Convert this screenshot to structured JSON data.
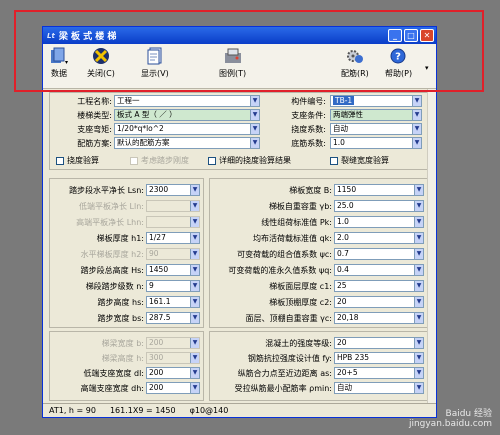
{
  "window": {
    "app_tag": "Lt",
    "title": "梁 板 式 楼 梯"
  },
  "toolbar": [
    {
      "name": "data-button",
      "label": "数据",
      "menu": true
    },
    {
      "name": "close-button",
      "label": "关闭(C)"
    },
    {
      "name": "display-button",
      "label": "显示(V)"
    },
    {
      "name": "drawing-button",
      "label": "图例(T)"
    },
    {
      "name": "rebar-button",
      "label": "配筋(R)"
    },
    {
      "name": "help-button",
      "label": "帮助(P)",
      "menu": true
    }
  ],
  "top": {
    "left": [
      {
        "label": "工程名称:",
        "value": "工程一"
      },
      {
        "label": "楼梯类型:",
        "value": "板式 A 型（ ／ ）"
      },
      {
        "label": "支座弯矩:",
        "value": "1/20*q*lo^2"
      },
      {
        "label": "配筋方案:",
        "value": "默认的配筋方案"
      }
    ],
    "right": [
      {
        "label": "构件编号:",
        "value": "TB-1"
      },
      {
        "label": "支座条件:",
        "value": "两端弹性"
      },
      {
        "label": "挠度系数:",
        "value": "自动"
      },
      {
        "label": "底筋系数:",
        "value": "1.0"
      }
    ],
    "checks": [
      "挠度验算",
      "考虑踏步刚度",
      "详细的挠度验算结果",
      "裂缝宽度验算"
    ]
  },
  "mid": {
    "left": [
      {
        "label": "踏步段水平净长 Lsn:",
        "value": "2300",
        "dis": false
      },
      {
        "label": "低端平板净长 Lln:",
        "value": "",
        "dis": true
      },
      {
        "label": "高端平板净长 Lhn:",
        "value": "",
        "dis": true
      },
      {
        "label": "梯板厚度 h1:",
        "value": "1/27",
        "dis": false
      },
      {
        "label": "水平梯板厚度 h2:",
        "value": "90",
        "dis": true
      },
      {
        "label": "踏步段总高度 Hs:",
        "value": "1450",
        "dis": false
      },
      {
        "label": "梯段踏步级数 n:",
        "value": "9",
        "dis": false
      },
      {
        "label": "踏步高度 hs:",
        "value": "161.1",
        "dis": false
      },
      {
        "label": "踏步宽度 bs:",
        "value": "287.5",
        "dis": false
      }
    ],
    "right": [
      {
        "label": "梯板宽度 B:",
        "value": "1150"
      },
      {
        "label": "梯板自重容重 γb:",
        "value": "25.0"
      },
      {
        "label": "线性组荷标准值 Pk:",
        "value": "1.0"
      },
      {
        "label": "均布活荷载标准值 qk:",
        "value": "2.0"
      },
      {
        "label": "可变荷载的组合值系数 ψc:",
        "value": "0.7"
      },
      {
        "label": "可变荷载的准永久值系数 ψq:",
        "value": "0.4"
      },
      {
        "label": "梯板面层厚度 c1:",
        "value": "25"
      },
      {
        "label": "梯板顶棚厚度 c2:",
        "value": "20"
      },
      {
        "label": "面层、顶棚自重容重 γc:",
        "value": "20,18"
      }
    ]
  },
  "bottom": {
    "left": [
      {
        "label": "梯梁宽度 b:",
        "value": "200",
        "dis": true
      },
      {
        "label": "梯梁高度 h:",
        "value": "300",
        "dis": true
      },
      {
        "label": "低端支座宽度 dl:",
        "value": "200",
        "dis": false
      },
      {
        "label": "高端支座宽度 dh:",
        "value": "200",
        "dis": false
      }
    ],
    "right": [
      {
        "label": "混凝土的强度等级:",
        "value": "20"
      },
      {
        "label": "钢筋抗拉强度设计值 fy:",
        "value": "HPB 235"
      },
      {
        "label": "纵筋合力点至近边距离 as:",
        "value": "20+5"
      },
      {
        "label": "受拉纵筋最小配筋率 ρmin:",
        "value": "自动"
      }
    ]
  },
  "status": [
    "AT1, h = 90",
    "161.1X9 = 1450",
    "φ10@140"
  ],
  "watermark": {
    "line1": "Baidu 经验",
    "line2": "jingyan.baidu.com"
  }
}
